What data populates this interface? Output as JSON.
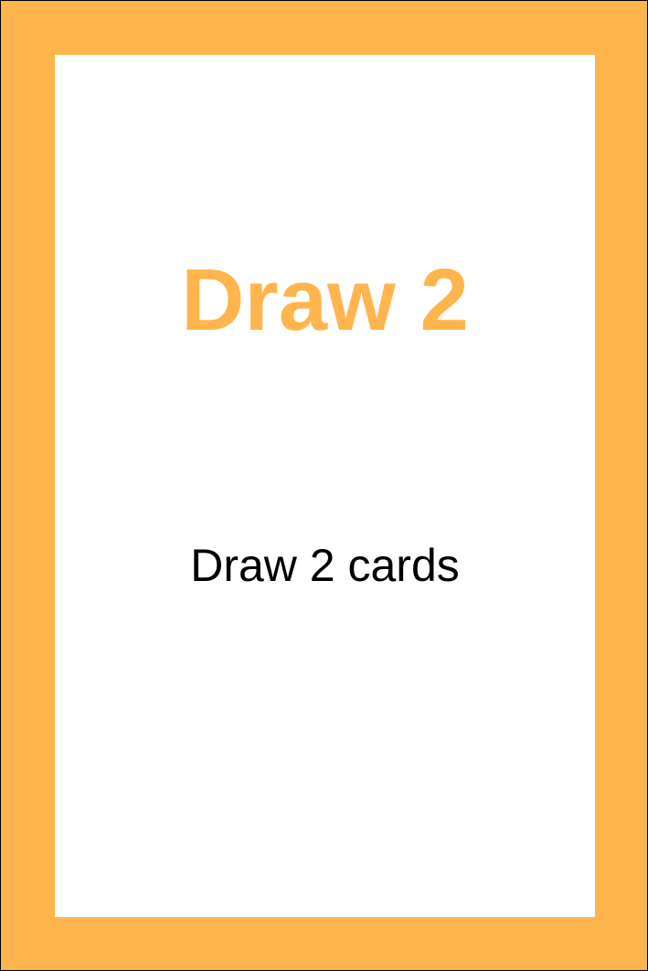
{
  "card": {
    "title": "Draw 2",
    "description": "Draw 2 cards",
    "colors": {
      "border": "#FFB54D",
      "face": "#FFFFFF",
      "title": "#FFB54D",
      "description": "#000000"
    }
  }
}
